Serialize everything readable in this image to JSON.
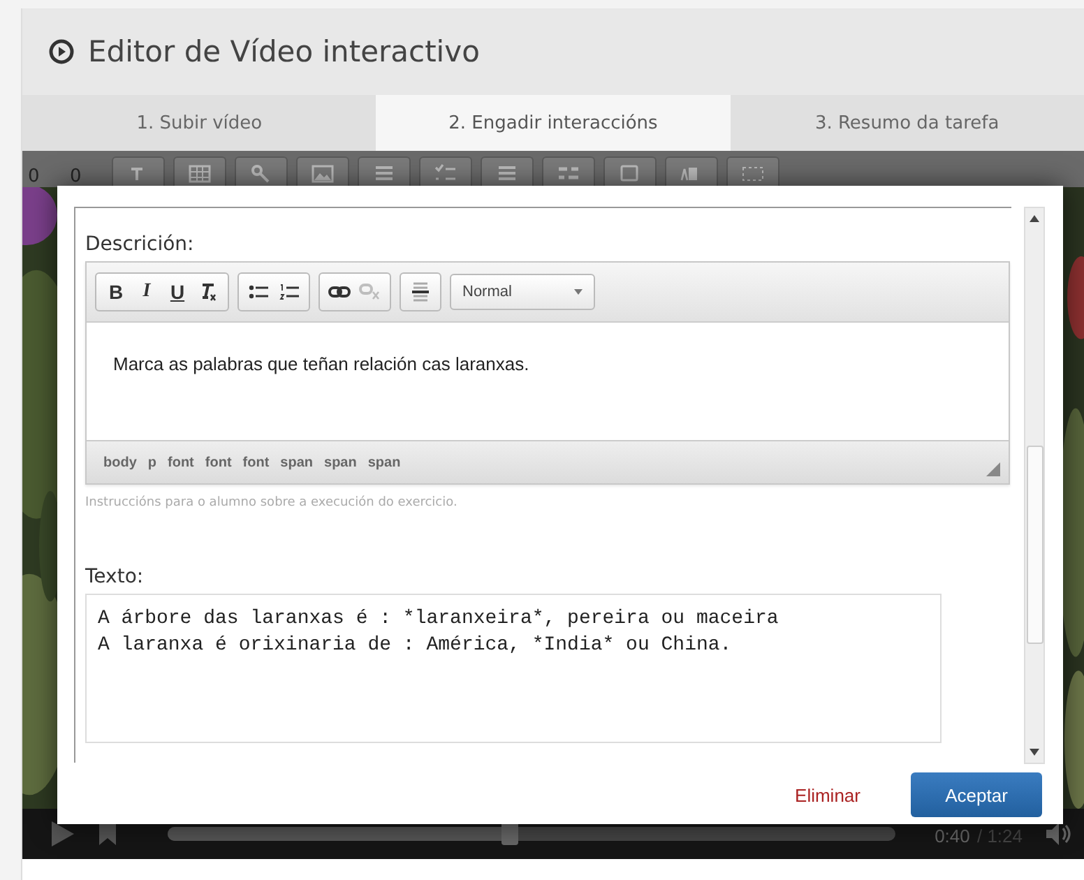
{
  "header": {
    "title": "Editor de Vídeo interactivo"
  },
  "tabs": [
    {
      "label": "1. Subir vídeo",
      "selected": false
    },
    {
      "label": "2. Engadir interaccións",
      "selected": true
    },
    {
      "label": "3. Resumo da tarefa",
      "selected": false
    }
  ],
  "video": {
    "toolbar_values": [
      "0",
      "0"
    ],
    "player": {
      "level": 0.47,
      "time": "0:40",
      "duration": "/ 1:24"
    }
  },
  "dialog": {
    "description": {
      "label": "Descrición:",
      "toolbar_groups": [
        [
          {
            "kind": "bold",
            "label": "B",
            "disabled": false
          },
          {
            "kind": "italic",
            "label": "I",
            "disabled": false
          },
          {
            "kind": "underline",
            "label": "U",
            "disabled": false
          },
          {
            "kind": "clear-format",
            "disabled": false
          }
        ],
        [
          {
            "kind": "bullet-list",
            "disabled": false
          },
          {
            "kind": "numbered-list",
            "disabled": false
          }
        ],
        [
          {
            "kind": "link",
            "disabled": false
          },
          {
            "kind": "unlink",
            "disabled": true
          }
        ],
        [
          {
            "kind": "rule",
            "disabled": false
          }
        ]
      ],
      "format": "Normal",
      "content": "Marca as palabras que teñan relación cas laranxas.",
      "path": [
        "body",
        "p",
        "font",
        "font",
        "font",
        "span",
        "span",
        "span"
      ],
      "hint": "Instruccións para o alumno sobre a execución do exercicio."
    },
    "text": {
      "label": "Texto:",
      "value": "A árbore das laranxas é : *laranxeira*, pereira ou maceira\nA laranxa é orixinaria de : América, *India* ou China."
    },
    "buttons": [
      {
        "label": "Eliminar",
        "kind": "link"
      },
      {
        "label": "Aceptar",
        "kind": "primary"
      }
    ]
  }
}
